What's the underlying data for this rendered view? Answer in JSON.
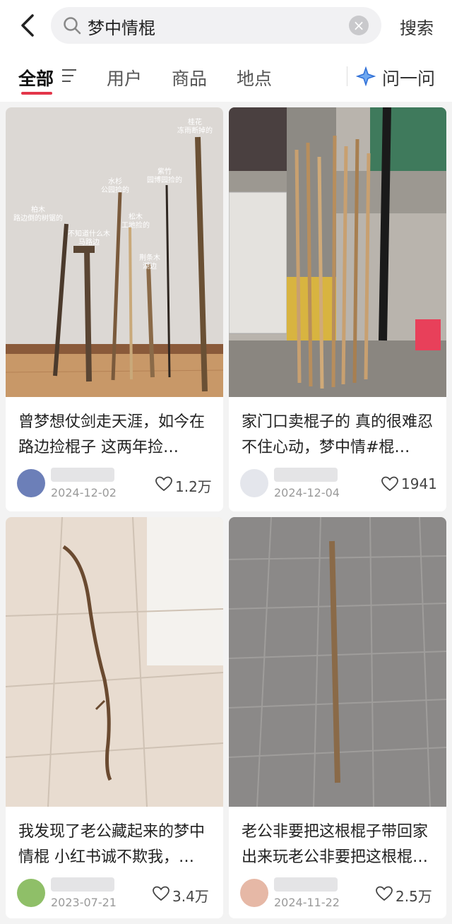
{
  "header": {
    "query": "梦中情棍",
    "search_label": "搜索"
  },
  "tabs": [
    {
      "label": "全部",
      "active": true
    },
    {
      "label": "用户"
    },
    {
      "label": "商品"
    },
    {
      "label": "地点"
    }
  ],
  "ask": {
    "label": "问一问"
  },
  "accent_color": "#e3364a",
  "cards": [
    {
      "title": "曾梦想仗剑走天涯，如今在路边捡棍子 这两年捡…",
      "date": "2024-12-02",
      "likes": "1.2万",
      "image_labels": [
        "桂花",
        "冻雨断掉的",
        "紫竹",
        "园博园捡的",
        "水杉",
        "公园捡的",
        "柏木",
        "路边倒的树锯的",
        "不知道什么木",
        "马路边",
        "松木",
        "工地捡的",
        "荆条木",
        "湖边"
      ]
    },
    {
      "title": "家门口卖棍子的 真的很难忍不住心动，梦中情#棍…",
      "date": "2024-12-04",
      "likes": "1941"
    },
    {
      "title": "我发现了老公藏起来的梦中情棍 小红书诚不欺我，…",
      "date": "2023-07-21",
      "likes": "3.4万"
    },
    {
      "title": "老公非要把这根棍子带回家出来玩老公非要把这根棍…",
      "date": "2024-11-22",
      "likes": "2.5万"
    }
  ]
}
